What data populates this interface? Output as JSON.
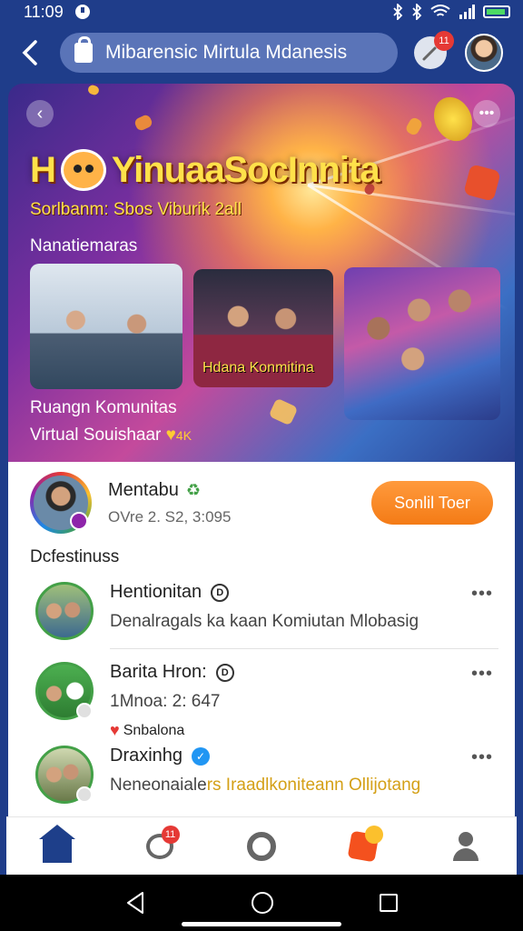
{
  "status_bar": {
    "time": "11:09"
  },
  "top_bar": {
    "search_text": "Mibarensic Mirtula Mdanesis",
    "notif_count": "11"
  },
  "hero": {
    "title": "YinuaaSocInnita",
    "subtitle": "Sorlbanm: Sbos Viburik 2all",
    "section_label": "Nanatiemaras",
    "photo_caption": "Hdana Konmitina",
    "caption_line1": "Ruangn Komunitas",
    "caption_line2": "Virtual Souishaar",
    "caption_badge": "4K"
  },
  "profile": {
    "name": "Mentabu",
    "meta": "OVre 2. S2, 3:095",
    "follow_label": "Sonlil Toer"
  },
  "section_heading": "Dcfestinuss",
  "feed": [
    {
      "title": "Hentionitan",
      "desc": "Denalragals ka kaan Komiutan Mlobasig"
    },
    {
      "title": "Barita Hron:",
      "desc": "1Mnoa: 2: 647",
      "extra": "Snbalona"
    },
    {
      "title": "Draxinhg",
      "desc_part1": "Neneonaiale",
      "desc_part2": "rs Iraadlkoniteann Ollijotang"
    }
  ],
  "bottom_nav": {
    "chat_badge": "11"
  },
  "colors": {
    "primary": "#1e3f8a",
    "accent": "#f47b16",
    "title_yellow": "#ffe14a"
  }
}
